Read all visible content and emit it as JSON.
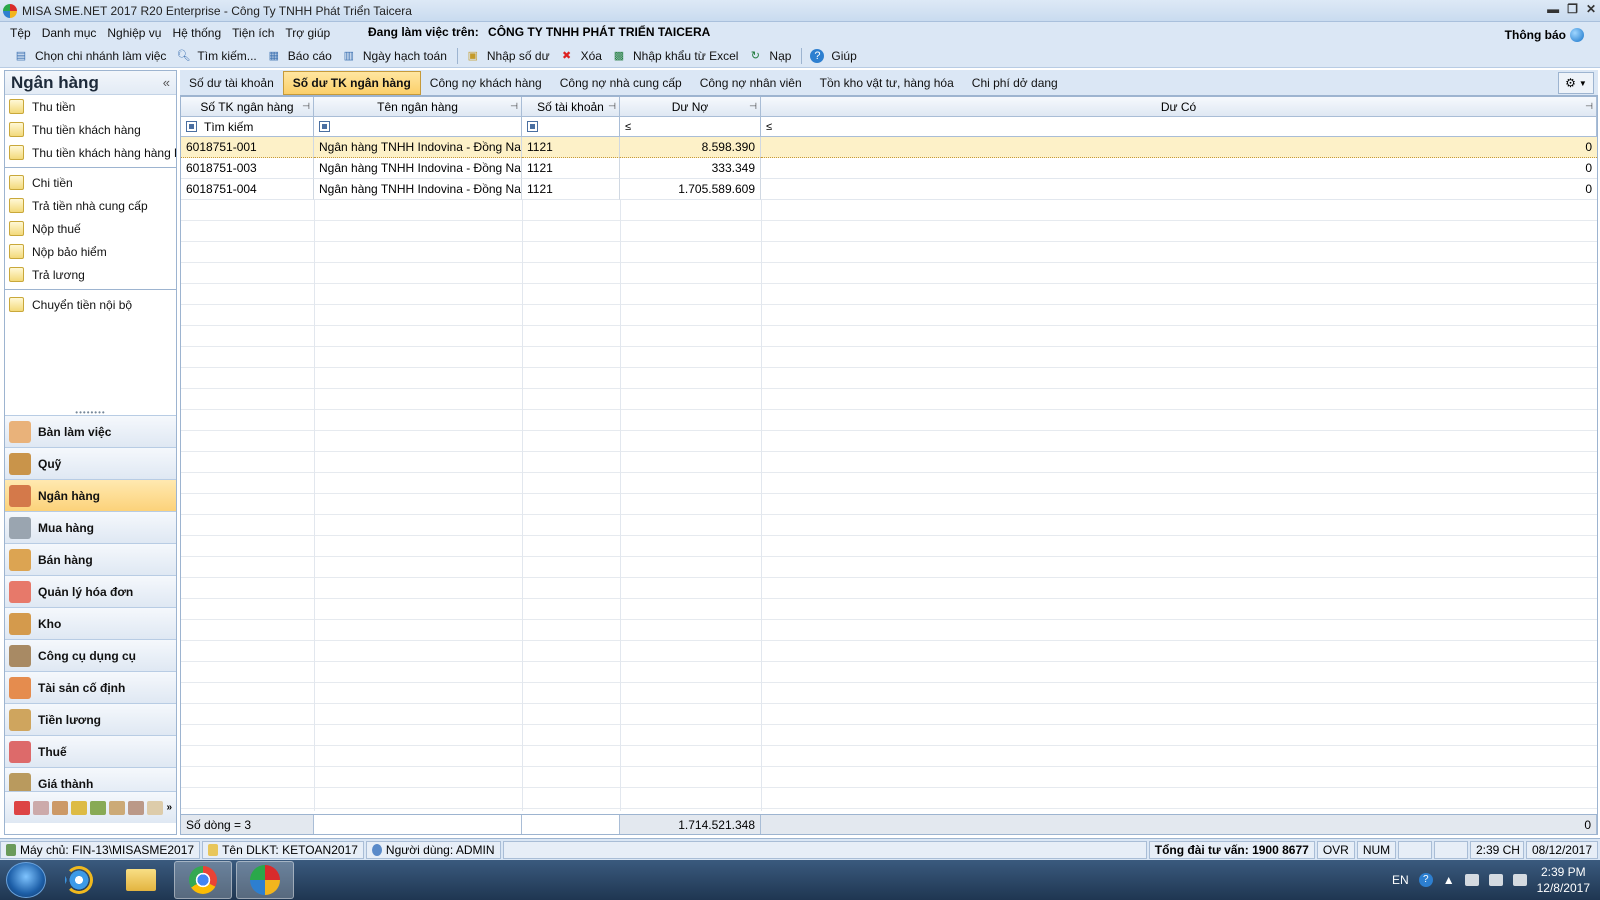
{
  "window": {
    "title": "MISA SME.NET 2017 R20 Enterprise - Công Ty TNHH Phát Triển Taicera",
    "minimize": "▬",
    "restore": "❐",
    "close": "✕"
  },
  "menu": [
    "Tệp",
    "Danh mục",
    "Nghiệp vụ",
    "Hệ thống",
    "Tiện ích",
    "Trợ giúp"
  ],
  "working_label": "Đang làm việc trên:",
  "working_company": "CÔNG TY TNHH PHÁT TRIỂN TAICERA",
  "notification_label": "Thông báo",
  "toolbar": [
    {
      "label": "Chọn chi nhánh làm việc",
      "icon": "branch-icon"
    },
    {
      "label": "Tìm kiếm...",
      "icon": "search-icon"
    },
    {
      "label": "Báo cáo",
      "icon": "report-icon"
    },
    {
      "label": "Ngày hạch toán",
      "icon": "calendar-icon"
    },
    {
      "label": "Nhập số dư",
      "icon": "import-balance-icon"
    },
    {
      "label": "Xóa",
      "icon": "delete-icon"
    },
    {
      "label": "Nhập khẩu từ Excel",
      "icon": "excel-icon"
    },
    {
      "label": "Nạp",
      "icon": "reload-icon"
    },
    {
      "label": "Giúp",
      "icon": "help-icon"
    }
  ],
  "sidebar": {
    "title": "Ngân hàng",
    "collapse": "«",
    "groups": [
      [
        "Thu tiền",
        "Thu tiền khách hàng",
        "Thu tiền khách hàng hàng l..."
      ],
      [
        "Chi tiền",
        "Trả tiền nhà cung cấp",
        "Nộp thuế",
        "Nộp bảo hiểm",
        "Trả lương"
      ],
      [
        "Chuyển tiền nội bộ"
      ]
    ],
    "modules": [
      {
        "label": "Bàn làm việc",
        "icon": "desk-icon",
        "color": "#d8893a"
      },
      {
        "label": "Quỹ",
        "icon": "cash-box-icon",
        "color": "#b3782c"
      },
      {
        "label": "Ngân hàng",
        "icon": "bank-icon",
        "color": "#c0572c"
      },
      {
        "label": "Mua hàng",
        "icon": "purchase-icon",
        "color": "#6f7c88"
      },
      {
        "label": "Bán hàng",
        "icon": "sales-icon",
        "color": "#c88a2e"
      },
      {
        "label": "Quản lý hóa đơn",
        "icon": "invoice-icon",
        "color": "#d44b3a"
      },
      {
        "label": "Kho",
        "icon": "warehouse-icon",
        "color": "#c07a24"
      },
      {
        "label": "Công cụ dụng cụ",
        "icon": "tools-icon",
        "color": "#8a6a44"
      },
      {
        "label": "Tài sản cố định",
        "icon": "fixed-asset-icon",
        "color": "#d36a2c"
      },
      {
        "label": "Tiền lương",
        "icon": "salary-icon",
        "color": "#b98a3a"
      },
      {
        "label": "Thuế",
        "icon": "tax-icon",
        "color": "#c43d3d"
      },
      {
        "label": "Giá thành",
        "icon": "cost-icon",
        "color": "#9b7a3c"
      }
    ],
    "active_module": "Ngân hàng"
  },
  "tabs": [
    "Số dư tài khoản",
    "Số dư TK ngân hàng",
    "Công nợ khách hàng",
    "Công nợ nhà cung cấp",
    "Công nợ nhân viên",
    "Tồn kho vật tư, hàng hóa",
    "Chi phí dở dang"
  ],
  "active_tab": "Số dư TK ngân hàng",
  "grid": {
    "columns": [
      "Số TK ngân hàng",
      "Tên ngân hàng",
      "Số tài khoản",
      "Dư Nợ",
      "Dư Có"
    ],
    "filter_placeholder": "Tìm kiếm",
    "filter_op": "≤",
    "rows": [
      [
        "6018751-001",
        "Ngân hàng TNHH Indovina - Đồng Nai",
        "1121",
        "8.598.390",
        "0"
      ],
      [
        "6018751-003",
        "Ngân hàng TNHH Indovina - Đồng Nai",
        "1121",
        "333.349",
        "0"
      ],
      [
        "6018751-004",
        "Ngân hàng TNHH Indovina - Đồng Nai",
        "1121",
        "1.705.589.609",
        "0"
      ]
    ],
    "footer_count": "Số dòng = 3",
    "footer_debit": "1.714.521.348",
    "footer_credit": "0"
  },
  "status": {
    "server": "Máy chủ: FIN-13\\MISASME2017",
    "db": "Tên DLKT: KETOAN2017",
    "user": "Người dùng: ADMIN",
    "hotline": "Tổng đài tư vấn: 1900 8677",
    "ovr": "OVR",
    "num": "NUM",
    "time": "2:39 CH",
    "date": "08/12/2017"
  },
  "taskbar": {
    "lang": "EN",
    "clock_time": "2:39 PM",
    "clock_date": "12/8/2017"
  }
}
